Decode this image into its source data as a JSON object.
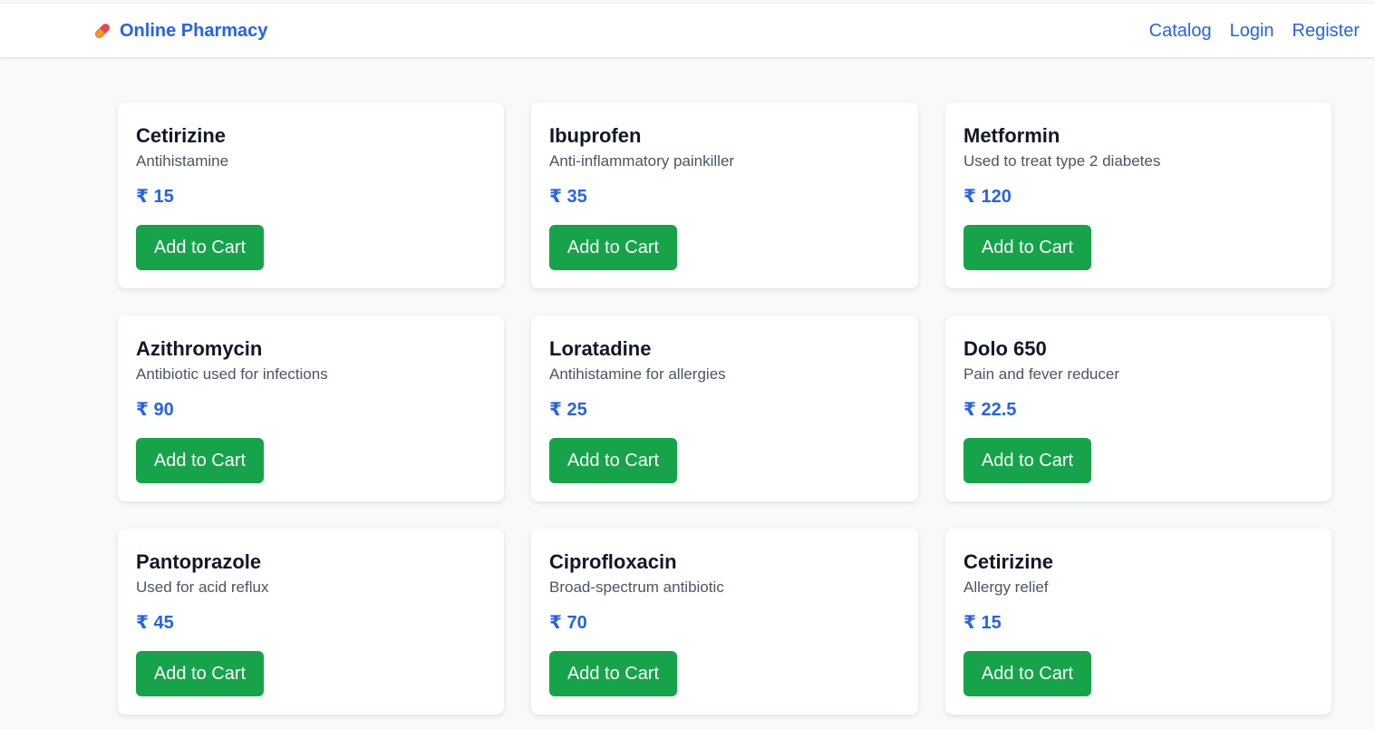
{
  "header": {
    "brand_icon": "pill-icon",
    "brand_text": "Online Pharmacy",
    "nav": [
      {
        "label": "Catalog"
      },
      {
        "label": "Login"
      },
      {
        "label": "Register"
      }
    ]
  },
  "colors": {
    "accent": "#2563eb",
    "button": "#16a34a",
    "background": "#f8f9fb"
  },
  "currency_symbol": "₹",
  "products": [
    {
      "name": "Cetirizine",
      "description": "Antihistamine",
      "price": "₹ 15",
      "button": "Add to Cart"
    },
    {
      "name": "Ibuprofen",
      "description": "Anti-inflammatory painkiller",
      "price": "₹ 35",
      "button": "Add to Cart"
    },
    {
      "name": "Metformin",
      "description": "Used to treat type 2 diabetes",
      "price": "₹ 120",
      "button": "Add to Cart"
    },
    {
      "name": "Azithromycin",
      "description": "Antibiotic used for infections",
      "price": "₹ 90",
      "button": "Add to Cart"
    },
    {
      "name": "Loratadine",
      "description": "Antihistamine for allergies",
      "price": "₹ 25",
      "button": "Add to Cart"
    },
    {
      "name": "Dolo 650",
      "description": "Pain and fever reducer",
      "price": "₹ 22.5",
      "button": "Add to Cart"
    },
    {
      "name": "Pantoprazole",
      "description": "Used for acid reflux",
      "price": "₹ 45",
      "button": "Add to Cart"
    },
    {
      "name": "Ciprofloxacin",
      "description": "Broad-spectrum antibiotic",
      "price": "₹ 70",
      "button": "Add to Cart"
    },
    {
      "name": "Cetirizine",
      "description": "Allergy relief",
      "price": "₹ 15",
      "button": "Add to Cart"
    }
  ]
}
